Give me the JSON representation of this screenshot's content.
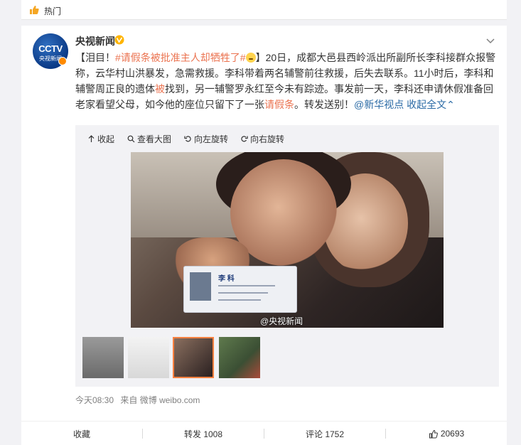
{
  "top": {
    "label": "热门"
  },
  "post": {
    "author": "央视新闻",
    "avatar_text": "CCTV",
    "avatar_sub": "央视新闻",
    "text_prefix": "【泪目！",
    "hashtag": "#请假条被批准主人却牺牲了#",
    "text_body": "】20日，成都大邑县西岭派出所副所长李科接群众报警称，云华村山洪暴发，急需救援。李科带着两名辅警前往救援，后失去联系。11小时后，李科和辅警周正良的遗体",
    "text_red1": "被",
    "text_body2": "找到，另一辅警罗永红至今未有踪迹。事发前一天，李科还申请休假准备回老家看望父母，如今他的座位只留下了一张",
    "text_red2": "请假条",
    "text_body3": "。转发送别！",
    "mention": "@新华视点",
    "collapse": "收起全文",
    "time": "今天08:30",
    "source_label": "来自",
    "source": "微博 weibo.com"
  },
  "media": {
    "tools": [
      "收起",
      "查看大图",
      "向左旋转",
      "向右旋转"
    ],
    "watermark": "@央视新闻",
    "badge_name": "李  科"
  },
  "actions": {
    "favorite": "收藏",
    "repost": "转发 1008",
    "comment": "评论 1752",
    "like": "20693"
  },
  "colors": {
    "link": "#eb7350",
    "blue": "#2a6aa5",
    "active_thumb": "#ff8140"
  }
}
